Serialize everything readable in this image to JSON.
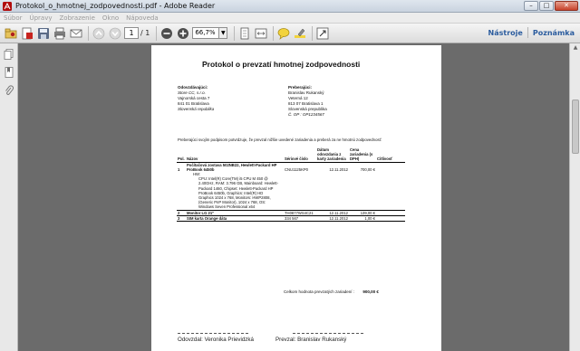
{
  "window": {
    "title": "Protokol_o_hmotnej_zodpovednosti.pdf - Adobe Reader",
    "minimize": "–",
    "maximize": "□",
    "close": "✕"
  },
  "menu": [
    "Súbor",
    "Úpravy",
    "Zobrazenie",
    "Okno",
    "Nápoveda"
  ],
  "toolbar": {
    "page_current": "1",
    "page_total": "/ 1",
    "zoom": "66,7%",
    "tools_link": "Nástroje",
    "comments_link": "Poznámka"
  },
  "document": {
    "title": "Protokol o prevzatí hmotnej zodpovednosti",
    "handover": {
      "heading": "Odovzdávajúci:",
      "lines": [
        "Store CC, s.r.o.",
        "Vajnorská cesta 7",
        "841 01 Bratislava",
        "Slovenská republika"
      ]
    },
    "receiver": {
      "heading": "Preberajúci:",
      "lines": [
        "Branislav Rukanský",
        "Veterná 12",
        "813 07 Bratislava 1",
        "Slovenská prepublika",
        "Č. OP : OP1234567"
      ]
    },
    "intro": "Preberajúci svojím podpisom potvrdzuje, že prevzal nižšie uvedené zariadenia a preberá za ne hmotnú zodpovednosť:",
    "columns": {
      "pos": "Pol.",
      "name": "Názov",
      "serial": "Sériové číslo",
      "date": "Dátum odovzdania z karty zariadenia",
      "price": "Cena zariadenia (s DPH)",
      "counter": "Citlivosť"
    },
    "items": [
      {
        "group": "Počítačová zostava 502NB22, Hewlett-Packard HP",
        "pos": "1",
        "name": "ProBook 6450b",
        "serial": "CNU1125KP0",
        "date": "12.11.2012",
        "price": "700,00 €",
        "hw_label": "HW:",
        "desc": [
          "CPU: Intel(R) Core(TM) i5 CPU    M 450  @",
          "2.40GHz, RAM: 3.796 GB, Mainboard: Hewlett-",
          "Packard 1460, Chipset: Hewlett-Packard HP",
          "ProBook 6450b, Graphics: Intel(R) HD",
          "Graphics 1024 x 768, Monitors: HWP2808,",
          "(Generic PnP Monitor), 1024 x 768, OS:",
          "Windows Seven Professional x64"
        ]
      },
      {
        "pos": "2",
        "name": "Monitor LG 21\"",
        "serial": "TH0877WS4C21",
        "date": "12.11.2012",
        "price": "139,00 €"
      },
      {
        "pos": "3",
        "name": "SIM  karta Orange dáta",
        "serial": "334 567",
        "date": "12.11.2012",
        "price": "1,00 €"
      }
    ],
    "total_label": "Celkom hodnota prevzatých zariadení :",
    "total_value": "900,00 €",
    "signature_left": "Odovzdal:  Veronika Prievidzká",
    "signature_right": "Prevzal:  Branislav Rukanský"
  }
}
